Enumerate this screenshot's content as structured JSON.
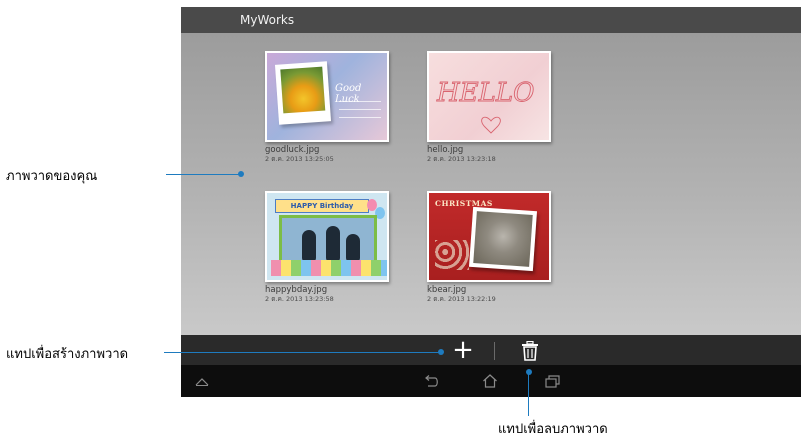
{
  "app": {
    "title": "MyWorks"
  },
  "works": [
    {
      "name": "goodluck.jpg",
      "date": "2 ต.ค. 2013 13:25:05",
      "thumb_text": "Good Luck"
    },
    {
      "name": "hello.jpg",
      "date": "2 ต.ค. 2013 13:23:18",
      "thumb_text": "HELLO"
    },
    {
      "name": "happybday.jpg",
      "date": "2 ต.ค. 2013 13:23:58",
      "thumb_text": "HAPPY Birthday"
    },
    {
      "name": "kbear.jpg",
      "date": "2 ต.ค. 2013 13:22:19",
      "thumb_text": "CHRISTMAS"
    }
  ],
  "actionbar": {
    "add_symbol": "+",
    "add_icon": "plus-icon",
    "delete_icon": "trash-icon"
  },
  "navbar": {
    "icons": [
      "up-chevron-icon",
      "back-icon",
      "home-icon",
      "recent-apps-icon"
    ]
  },
  "annotations": {
    "your_drawings": "ภาพวาดของคุณ",
    "tap_to_create": "แทปเพื่อสร้างภาพวาด",
    "tap_to_delete": "แทปเพื่อลบภาพวาด"
  },
  "colors": {
    "accent_line": "#1e7bbf",
    "title_bar": "#4a4a4a",
    "action_bar": "#2a2a2a",
    "nav_bar": "#0d0d0d"
  }
}
